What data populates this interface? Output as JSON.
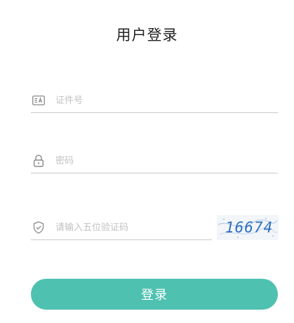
{
  "title": "用户登录",
  "fields": {
    "username": {
      "placeholder": "证件号",
      "icon": "id-card-icon"
    },
    "password": {
      "placeholder": "密码",
      "icon": "lock-icon"
    },
    "captcha": {
      "placeholder": "请输入五位验证码",
      "icon": "shield-icon",
      "image_text": "16674"
    }
  },
  "login_button": {
    "label": "登录",
    "color": "#4fc1b0"
  }
}
